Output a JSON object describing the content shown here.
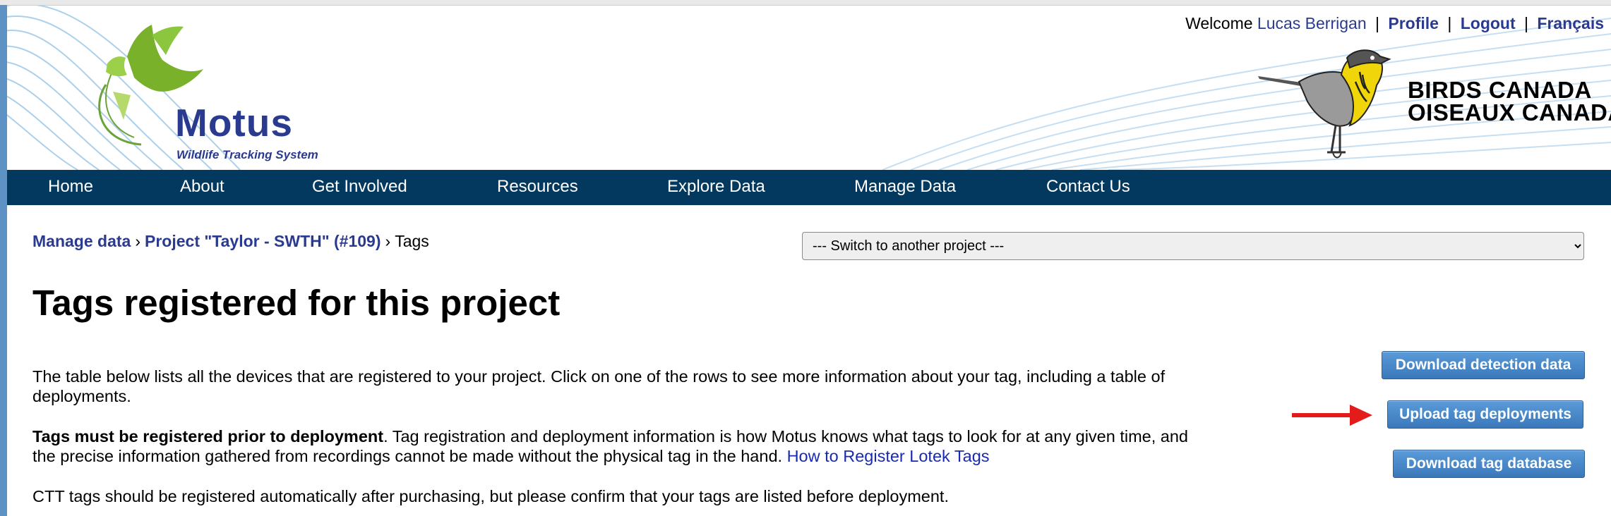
{
  "header": {
    "logo_name": "Motus",
    "logo_tagline": "Wildlife Tracking System",
    "welcome_prefix": "Welcome",
    "user_name": "Lucas Berrigan",
    "profile_link": "Profile",
    "logout_link": "Logout",
    "language_link": "Français",
    "separator": "|",
    "partner_line1": "BIRDS CANADA",
    "partner_line2": "OISEAUX CANADA"
  },
  "nav": {
    "items": [
      {
        "label": "Home"
      },
      {
        "label": "About"
      },
      {
        "label": "Get Involved"
      },
      {
        "label": "Resources"
      },
      {
        "label": "Explore Data"
      },
      {
        "label": "Manage Data"
      },
      {
        "label": "Contact Us"
      }
    ]
  },
  "breadcrumb": {
    "manage": "Manage data",
    "project": "Project \"Taylor - SWTH\" (#109)",
    "current": "Tags",
    "sep": "›"
  },
  "project_switcher": {
    "selected": "--- Switch to another project ---"
  },
  "main": {
    "title": "Tags registered for this project",
    "p1": "The table below lists all the devices that are registered to your project. Click on one of the rows to see more information about your tag, including a table of deployments.",
    "p2_bold": "Tags must be registered prior to deployment",
    "p2_text": ". Tag registration and deployment information is how Motus knows what tags to look for at any given time, and the precise information gathered from recordings cannot be made without the physical tag in the hand.",
    "p2_link": "How to Register Lotek Tags",
    "p3": "CTT tags should be registered automatically after purchasing, but please confirm that your tags are listed before deployment."
  },
  "actions": {
    "download_detection": "Download detection data",
    "upload_deployments": "Upload tag deployments",
    "download_tag_db": "Download tag database"
  },
  "colors": {
    "nav_bg": "#03395f",
    "link": "#2a3b8f",
    "button": "#3a78bb",
    "arrow": "#e31b1b"
  }
}
